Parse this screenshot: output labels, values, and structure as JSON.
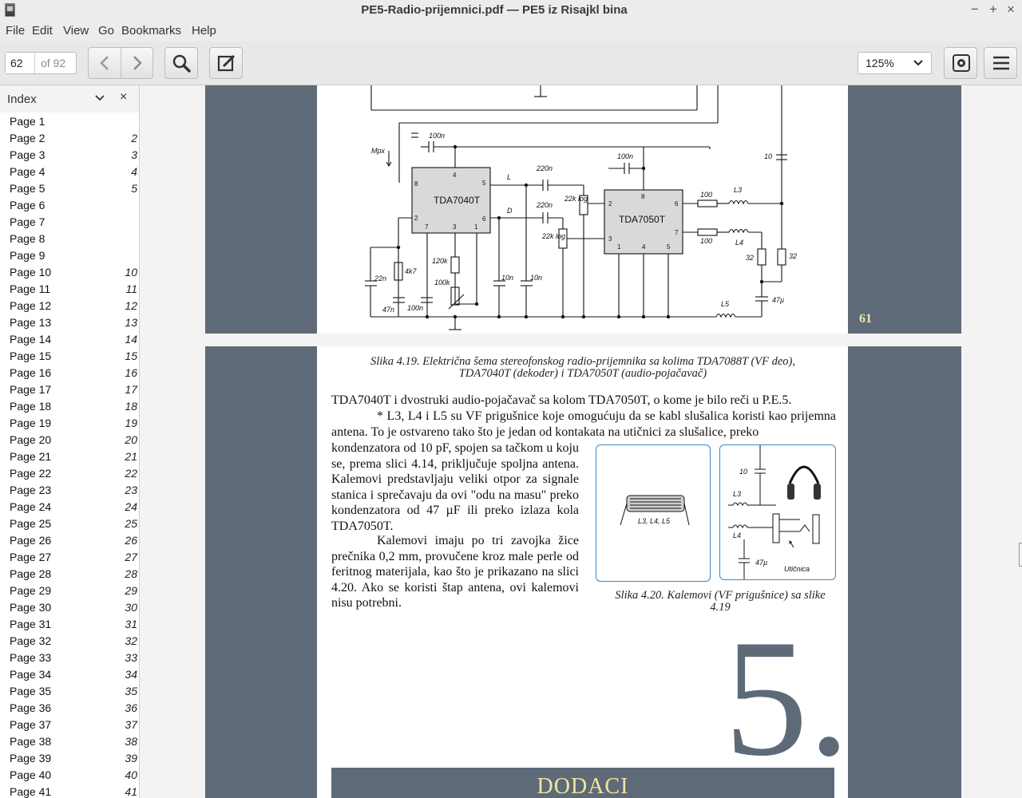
{
  "window": {
    "title": "PE5-Radio-prijemnici.pdf — PE5 iz Risajkl bina",
    "minimize": "−",
    "maximize": "+",
    "close": "×"
  },
  "menu": [
    "File",
    "Edit",
    "View",
    "Go",
    "Bookmarks",
    "Help"
  ],
  "toolbar": {
    "page_value": "62",
    "page_total": "of 92",
    "zoom": "125%"
  },
  "sidebar": {
    "title": "Index",
    "close": "×",
    "items": [
      {
        "label": "Page 1",
        "num": ""
      },
      {
        "label": "Page 2",
        "num": "2"
      },
      {
        "label": "Page 3",
        "num": "3"
      },
      {
        "label": "Page 4",
        "num": "4"
      },
      {
        "label": "Page 5",
        "num": "5"
      },
      {
        "label": "Page 6",
        "num": ""
      },
      {
        "label": "Page 7",
        "num": ""
      },
      {
        "label": "Page 8",
        "num": ""
      },
      {
        "label": "Page 9",
        "num": ""
      },
      {
        "label": "Page 10",
        "num": "10"
      },
      {
        "label": "Page 11",
        "num": "11"
      },
      {
        "label": "Page 12",
        "num": "12"
      },
      {
        "label": "Page 13",
        "num": "13"
      },
      {
        "label": "Page 14",
        "num": "14"
      },
      {
        "label": "Page 15",
        "num": "15"
      },
      {
        "label": "Page 16",
        "num": "16"
      },
      {
        "label": "Page 17",
        "num": "17"
      },
      {
        "label": "Page 18",
        "num": "18"
      },
      {
        "label": "Page 19",
        "num": "19"
      },
      {
        "label": "Page 20",
        "num": "20"
      },
      {
        "label": "Page 21",
        "num": "21"
      },
      {
        "label": "Page 22",
        "num": "22"
      },
      {
        "label": "Page 23",
        "num": "23"
      },
      {
        "label": "Page 24",
        "num": "24"
      },
      {
        "label": "Page 25",
        "num": "25"
      },
      {
        "label": "Page 26",
        "num": "26"
      },
      {
        "label": "Page 27",
        "num": "27"
      },
      {
        "label": "Page 28",
        "num": "28"
      },
      {
        "label": "Page 29",
        "num": "29"
      },
      {
        "label": "Page 30",
        "num": "30"
      },
      {
        "label": "Page 31",
        "num": "31"
      },
      {
        "label": "Page 32",
        "num": "32"
      },
      {
        "label": "Page 33",
        "num": "33"
      },
      {
        "label": "Page 34",
        "num": "34"
      },
      {
        "label": "Page 35",
        "num": "35"
      },
      {
        "label": "Page 36",
        "num": "36"
      },
      {
        "label": "Page 37",
        "num": "37"
      },
      {
        "label": "Page 38",
        "num": "38"
      },
      {
        "label": "Page 39",
        "num": "39"
      },
      {
        "label": "Page 40",
        "num": "40"
      },
      {
        "label": "Page 41",
        "num": "41"
      }
    ]
  },
  "document": {
    "page1_number": "61",
    "schematic": {
      "ic1": "TDA7040T",
      "ic2": "TDA7050T",
      "c100n_a": "100n",
      "c100n_b": "100n",
      "c100n_c": "100n",
      "mpx": "Mpx",
      "l_ch": "L",
      "d_ch": "D",
      "c220n_a": "220n",
      "c220n_b": "220n",
      "pot_a": "22k log",
      "pot_b": "22k log",
      "r120k": "120k",
      "r100k": "100k",
      "r4k7": "4k7",
      "c22n": "22n",
      "c47n": "47n",
      "c10n_a": "10n",
      "c10n_b": "10n",
      "r100_a": "100",
      "r100_b": "100",
      "l3": "L3",
      "l4": "L4",
      "l5": "L5",
      "r32_a": "32",
      "r32_b": "32",
      "c10": "10",
      "c47u": "47µ",
      "pins": [
        "8",
        "4",
        "5",
        "2",
        "7",
        "3",
        "1",
        "6",
        "8",
        "2",
        "3",
        "6",
        "7",
        "1",
        "4",
        "5"
      ]
    },
    "caption_419": "Slika 4.19. Električna šema stereofonskog  radio-prijemnika sa kolima TDA7088T (VF deo), TDA7040T (dekoder) i TDA7050T (audio-pojačavač)",
    "para1": "TDA7040T i dvostruki audio-pojačavač sa kolom TDA7050T, o kome je bilo reči u P.E.5.",
    "para2": "* L3, L4 i L5 su VF prigušnice koje omogućuju da se kabl slušalica koristi kao prijemna antena. To je ostvareno tako što je jedan od kontakata na utičnici za slušalice, preko",
    "para3": "kondenzatora od 10 pF, spojen sa tačkom u koju se, prema slici 4.14, priključuje spoljna antena. Kalemovi predstavljaju veliki otpor za signale stanica i sprečavaju da ovi \"odu na masu\" preko kondenzatora od 47 µF ili preko izlaza kola TDA7050T.",
    "para4": "Kalemovi imaju po tri zavojka žice prečnika 0,2 mm, provučene kroz male perle od feritnog materijala, kao što je prikazano na slici 4.20. Ako se koristi štap antena, ovi kalemovi nisu potrebni.",
    "fig_a_label": "L3, L4, L5",
    "fig_b": {
      "c10": "10",
      "l3": "L3",
      "l4": "L4",
      "c47u": "47µ",
      "jack": "Utičnica"
    },
    "caption_420": "Slika 4.20. Kalemovi (VF prigušnice) sa slike 4.19",
    "chapter_number": "5.",
    "chapter_title": "DODACI"
  }
}
